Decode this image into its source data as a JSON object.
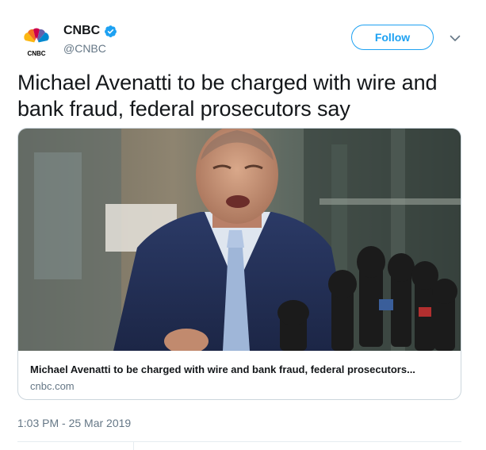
{
  "account": {
    "display_name": "CNBC",
    "handle": "@CNBC",
    "logo_text": "CNBC",
    "verified": true,
    "avatar_icon": "cnbc-peacock-icon",
    "brand_colors": [
      "#f37021",
      "#cc004c",
      "#6460aa",
      "#0089d0",
      "#0db14b",
      "#fcb711"
    ]
  },
  "actions": {
    "follow_label": "Follow",
    "menu_icon": "chevron-down-icon"
  },
  "tweet": {
    "text": "Michael Avenatti to be charged with wire and bank fraud, federal prosecutors say",
    "timestamp": "1:03 PM - 25 Mar 2019"
  },
  "card": {
    "title": "Michael Avenatti to be charged with wire and bank fraud, federal prosecutors...",
    "domain": "cnbc.com",
    "image_description_icon": "photo"
  },
  "colors": {
    "accent": "#1da1f2",
    "secondary_text": "#657786",
    "border": "#ccd6dd"
  }
}
